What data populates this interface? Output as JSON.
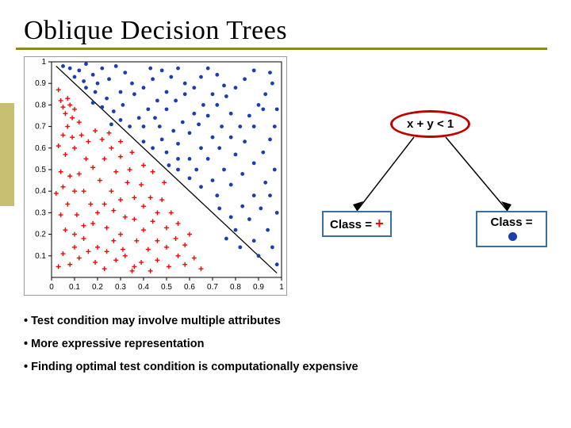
{
  "title": "Oblique Decision Trees",
  "side_tab_color": "#c8c070",
  "tree": {
    "root_label": "x + y < 1",
    "left_label_prefix": "Class = ",
    "left_symbol": "+",
    "right_label_prefix": "Class = ",
    "right_symbol": "dot",
    "root_border": "#c00000",
    "leaf_border": "#3a6ea5",
    "plus_color": "#ff0000",
    "dot_color": "#1a3db0"
  },
  "bullets": [
    "Test condition may involve multiple attributes",
    "More expressive representation",
    "Finding optimal test condition is computationally expensive"
  ],
  "chart_data": {
    "type": "scatter",
    "title": "",
    "xlabel": "",
    "ylabel": "",
    "xlim": [
      0,
      1
    ],
    "ylim": [
      0,
      1
    ],
    "x_ticks": [
      0,
      0.1,
      0.2,
      0.3,
      0.4,
      0.5,
      0.6,
      0.7,
      0.8,
      0.9,
      1
    ],
    "y_ticks": [
      0.1,
      0.2,
      0.3,
      0.4,
      0.5,
      0.6,
      0.7,
      0.8,
      0.9,
      1
    ],
    "boundary": {
      "equation": "x + y = 1",
      "x1": 0.02,
      "y1": 0.98,
      "x2": 0.98,
      "y2": 0.02
    },
    "series": [
      {
        "name": "Class +",
        "marker": "plus",
        "color": "#ff0000",
        "points": [
          [
            0.03,
            0.87
          ],
          [
            0.04,
            0.82
          ],
          [
            0.05,
            0.79
          ],
          [
            0.07,
            0.83
          ],
          [
            0.06,
            0.76
          ],
          [
            0.08,
            0.8
          ],
          [
            0.09,
            0.74
          ],
          [
            0.1,
            0.78
          ],
          [
            0.07,
            0.7
          ],
          [
            0.05,
            0.66
          ],
          [
            0.09,
            0.65
          ],
          [
            0.12,
            0.72
          ],
          [
            0.03,
            0.61
          ],
          [
            0.06,
            0.57
          ],
          [
            0.1,
            0.6
          ],
          [
            0.13,
            0.66
          ],
          [
            0.04,
            0.49
          ],
          [
            0.08,
            0.47
          ],
          [
            0.05,
            0.42
          ],
          [
            0.02,
            0.39
          ],
          [
            0.1,
            0.4
          ],
          [
            0.14,
            0.4
          ],
          [
            0.07,
            0.34
          ],
          [
            0.04,
            0.29
          ],
          [
            0.11,
            0.29
          ],
          [
            0.06,
            0.22
          ],
          [
            0.1,
            0.2
          ],
          [
            0.14,
            0.24
          ],
          [
            0.18,
            0.25
          ],
          [
            0.14,
            0.18
          ],
          [
            0.1,
            0.14
          ],
          [
            0.05,
            0.11
          ],
          [
            0.03,
            0.05
          ],
          [
            0.08,
            0.06
          ],
          [
            0.12,
            0.09
          ],
          [
            0.16,
            0.12
          ],
          [
            0.2,
            0.14
          ],
          [
            0.24,
            0.12
          ],
          [
            0.19,
            0.07
          ],
          [
            0.23,
            0.04
          ],
          [
            0.28,
            0.08
          ],
          [
            0.32,
            0.1
          ],
          [
            0.27,
            0.17
          ],
          [
            0.3,
            0.2
          ],
          [
            0.24,
            0.23
          ],
          [
            0.2,
            0.3
          ],
          [
            0.17,
            0.34
          ],
          [
            0.23,
            0.34
          ],
          [
            0.27,
            0.31
          ],
          [
            0.32,
            0.28
          ],
          [
            0.3,
            0.36
          ],
          [
            0.26,
            0.4
          ],
          [
            0.21,
            0.45
          ],
          [
            0.18,
            0.51
          ],
          [
            0.23,
            0.55
          ],
          [
            0.28,
            0.49
          ],
          [
            0.33,
            0.44
          ],
          [
            0.36,
            0.37
          ],
          [
            0.4,
            0.33
          ],
          [
            0.36,
            0.27
          ],
          [
            0.4,
            0.22
          ],
          [
            0.44,
            0.26
          ],
          [
            0.37,
            0.17
          ],
          [
            0.42,
            0.13
          ],
          [
            0.46,
            0.17
          ],
          [
            0.5,
            0.14
          ],
          [
            0.46,
            0.08
          ],
          [
            0.39,
            0.07
          ],
          [
            0.35,
            0.03
          ],
          [
            0.43,
            0.03
          ],
          [
            0.51,
            0.05
          ],
          [
            0.55,
            0.1
          ],
          [
            0.58,
            0.06
          ],
          [
            0.62,
            0.09
          ],
          [
            0.54,
            0.18
          ],
          [
            0.5,
            0.23
          ],
          [
            0.46,
            0.3
          ],
          [
            0.43,
            0.37
          ],
          [
            0.39,
            0.43
          ],
          [
            0.34,
            0.5
          ],
          [
            0.3,
            0.56
          ],
          [
            0.26,
            0.6
          ],
          [
            0.65,
            0.04
          ],
          [
            0.58,
            0.15
          ],
          [
            0.52,
            0.3
          ],
          [
            0.48,
            0.36
          ],
          [
            0.55,
            0.25
          ],
          [
            0.6,
            0.2
          ],
          [
            0.15,
            0.55
          ],
          [
            0.12,
            0.48
          ],
          [
            0.16,
            0.63
          ],
          [
            0.19,
            0.68
          ],
          [
            0.22,
            0.64
          ],
          [
            0.31,
            0.13
          ],
          [
            0.36,
            0.05
          ],
          [
            0.49,
            0.44
          ],
          [
            0.44,
            0.49
          ],
          [
            0.4,
            0.52
          ],
          [
            0.35,
            0.58
          ],
          [
            0.3,
            0.63
          ],
          [
            0.25,
            0.67
          ]
        ]
      },
      {
        "name": "Class dot",
        "marker": "dot",
        "color": "#1a3db0",
        "points": [
          [
            0.05,
            0.98
          ],
          [
            0.08,
            0.97
          ],
          [
            0.12,
            0.96
          ],
          [
            0.15,
            0.99
          ],
          [
            0.1,
            0.93
          ],
          [
            0.14,
            0.91
          ],
          [
            0.18,
            0.94
          ],
          [
            0.22,
            0.97
          ],
          [
            0.2,
            0.9
          ],
          [
            0.25,
            0.92
          ],
          [
            0.28,
            0.98
          ],
          [
            0.32,
            0.95
          ],
          [
            0.35,
            0.9
          ],
          [
            0.3,
            0.86
          ],
          [
            0.24,
            0.83
          ],
          [
            0.19,
            0.86
          ],
          [
            0.15,
            0.88
          ],
          [
            0.18,
            0.81
          ],
          [
            0.22,
            0.79
          ],
          [
            0.27,
            0.77
          ],
          [
            0.31,
            0.8
          ],
          [
            0.36,
            0.85
          ],
          [
            0.4,
            0.88
          ],
          [
            0.44,
            0.92
          ],
          [
            0.48,
            0.96
          ],
          [
            0.52,
            0.93
          ],
          [
            0.55,
            0.97
          ],
          [
            0.58,
            0.9
          ],
          [
            0.5,
            0.86
          ],
          [
            0.46,
            0.82
          ],
          [
            0.42,
            0.78
          ],
          [
            0.38,
            0.74
          ],
          [
            0.34,
            0.7
          ],
          [
            0.3,
            0.73
          ],
          [
            0.26,
            0.71
          ],
          [
            0.4,
            0.7
          ],
          [
            0.45,
            0.74
          ],
          [
            0.5,
            0.78
          ],
          [
            0.54,
            0.82
          ],
          [
            0.58,
            0.85
          ],
          [
            0.62,
            0.88
          ],
          [
            0.65,
            0.93
          ],
          [
            0.68,
            0.97
          ],
          [
            0.72,
            0.94
          ],
          [
            0.75,
            0.89
          ],
          [
            0.7,
            0.85
          ],
          [
            0.66,
            0.8
          ],
          [
            0.62,
            0.76
          ],
          [
            0.57,
            0.72
          ],
          [
            0.53,
            0.68
          ],
          [
            0.48,
            0.64
          ],
          [
            0.44,
            0.6
          ],
          [
            0.4,
            0.63
          ],
          [
            0.5,
            0.58
          ],
          [
            0.55,
            0.62
          ],
          [
            0.6,
            0.67
          ],
          [
            0.64,
            0.71
          ],
          [
            0.68,
            0.75
          ],
          [
            0.72,
            0.8
          ],
          [
            0.76,
            0.84
          ],
          [
            0.8,
            0.88
          ],
          [
            0.84,
            0.92
          ],
          [
            0.88,
            0.96
          ],
          [
            0.78,
            0.76
          ],
          [
            0.74,
            0.7
          ],
          [
            0.7,
            0.65
          ],
          [
            0.65,
            0.6
          ],
          [
            0.6,
            0.55
          ],
          [
            0.55,
            0.5
          ],
          [
            0.51,
            0.52
          ],
          [
            0.63,
            0.5
          ],
          [
            0.68,
            0.55
          ],
          [
            0.73,
            0.6
          ],
          [
            0.78,
            0.65
          ],
          [
            0.82,
            0.7
          ],
          [
            0.86,
            0.75
          ],
          [
            0.9,
            0.8
          ],
          [
            0.93,
            0.85
          ],
          [
            0.96,
            0.9
          ],
          [
            0.95,
            0.95
          ],
          [
            0.92,
            0.78
          ],
          [
            0.88,
            0.7
          ],
          [
            0.84,
            0.63
          ],
          [
            0.8,
            0.57
          ],
          [
            0.75,
            0.5
          ],
          [
            0.7,
            0.45
          ],
          [
            0.65,
            0.42
          ],
          [
            0.6,
            0.46
          ],
          [
            0.72,
            0.38
          ],
          [
            0.78,
            0.43
          ],
          [
            0.83,
            0.48
          ],
          [
            0.88,
            0.53
          ],
          [
            0.92,
            0.58
          ],
          [
            0.95,
            0.64
          ],
          [
            0.97,
            0.7
          ],
          [
            0.98,
            0.78
          ],
          [
            0.97,
            0.5
          ],
          [
            0.93,
            0.44
          ],
          [
            0.88,
            0.38
          ],
          [
            0.83,
            0.33
          ],
          [
            0.78,
            0.28
          ],
          [
            0.73,
            0.32
          ],
          [
            0.8,
            0.22
          ],
          [
            0.86,
            0.27
          ],
          [
            0.91,
            0.32
          ],
          [
            0.95,
            0.38
          ],
          [
            0.98,
            0.3
          ],
          [
            0.94,
            0.22
          ],
          [
            0.88,
            0.17
          ],
          [
            0.82,
            0.14
          ],
          [
            0.76,
            0.18
          ],
          [
            0.9,
            0.1
          ],
          [
            0.96,
            0.14
          ],
          [
            0.98,
            0.06
          ],
          [
            0.55,
            0.55
          ],
          [
            0.47,
            0.7
          ],
          [
            0.43,
            0.97
          ]
        ]
      }
    ]
  }
}
